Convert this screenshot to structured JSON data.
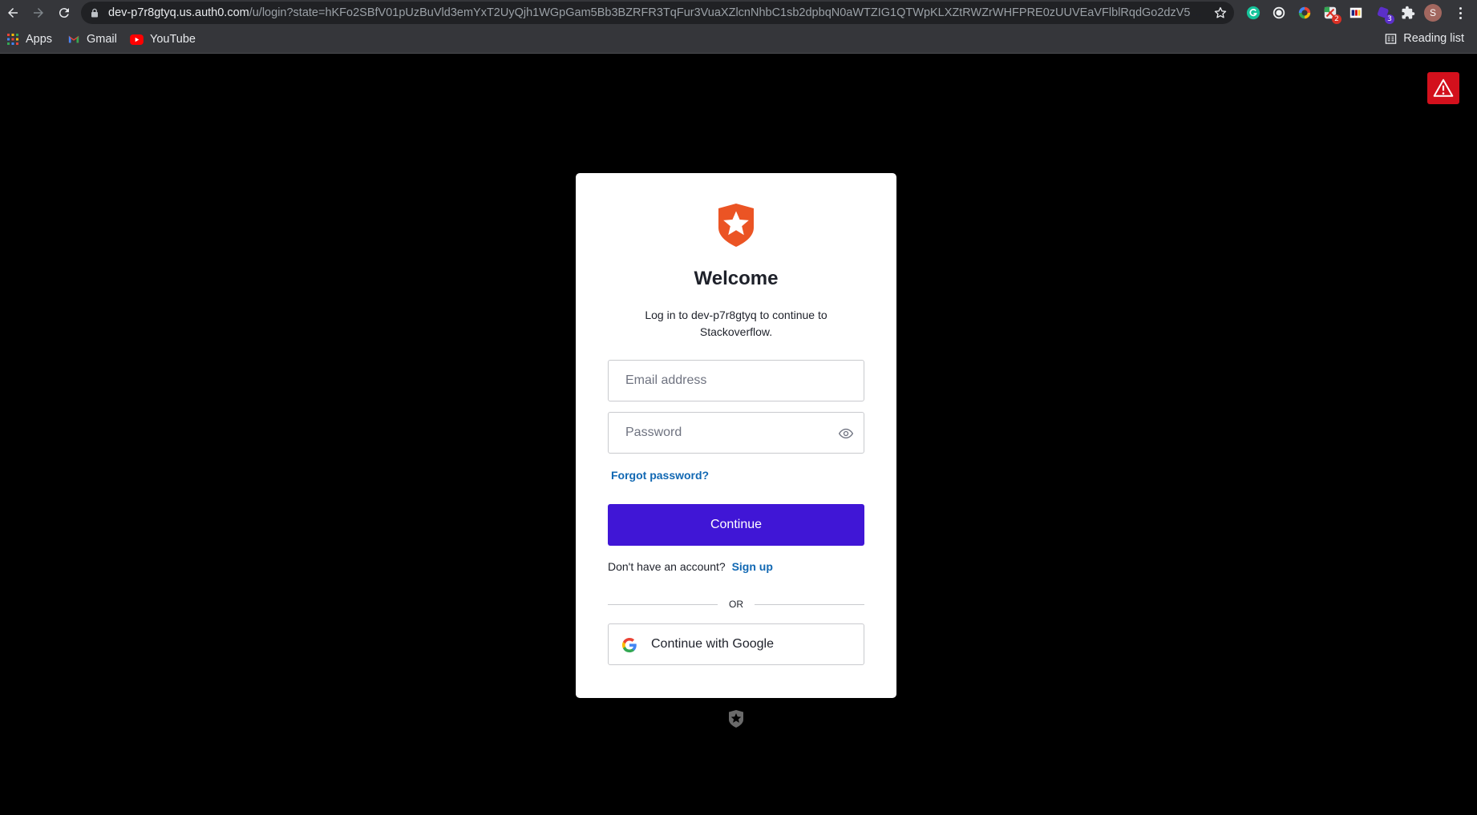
{
  "browser": {
    "url_host": "dev-p7r8gtyq.us.auth0.com",
    "url_path": "/u/login?state=hKFo2SBfV01pUzBuVld3emYxT2UyQjh1WGpGam5Bb3BZRFR3TqFur3VuaXZlcnNhbC1sb2dpbqN0aWTZIG1QTWpKLXZtRWZrWHFPRE0zUUVEaVFlblRqdGo2dzV5o2NpZNkg...",
    "extension_badges": [
      "2",
      "3"
    ],
    "profile_initial": "S",
    "bookmarks": [
      {
        "label": "Apps",
        "icon": "apps-grid-icon"
      },
      {
        "label": "Gmail",
        "icon": "gmail-icon"
      },
      {
        "label": "YouTube",
        "icon": "youtube-icon"
      }
    ],
    "reading_list_label": "Reading list"
  },
  "login": {
    "title": "Welcome",
    "subtitle": "Log in to dev-p7r8gtyq to continue to Stackoverflow.",
    "email_placeholder": "Email address",
    "password_placeholder": "Password",
    "forgot_label": "Forgot password?",
    "continue_label": "Continue",
    "no_account_text": "Don't have an account?",
    "signup_label": "Sign up",
    "or_label": "OR",
    "google_label": "Continue with Google"
  },
  "colors": {
    "page_bg": "#000000",
    "brand_orange": "#eb5424",
    "primary_button": "#4016d6",
    "link": "#1168b3",
    "alert_red": "#d3101c"
  }
}
